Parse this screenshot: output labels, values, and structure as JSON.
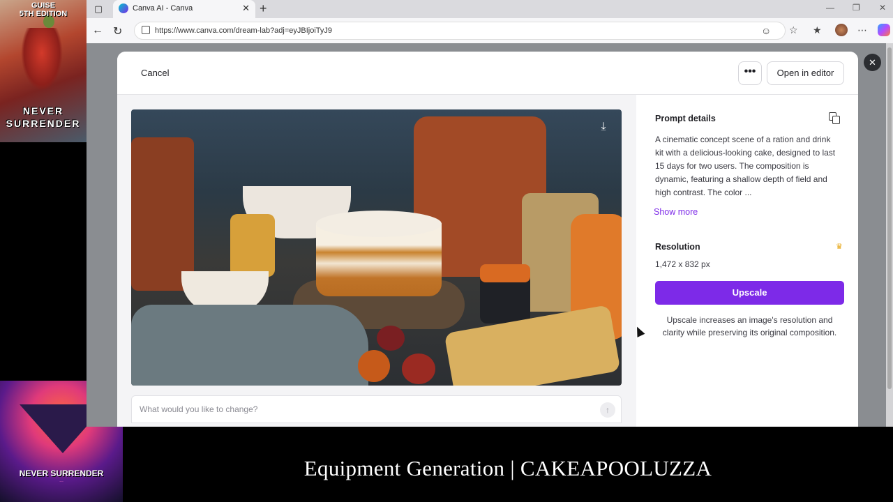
{
  "overlays": {
    "top_poster": {
      "line1": "GUISE",
      "line2": "5TH EDITION",
      "line3": "NEVER",
      "line4": "SURRENDER"
    },
    "bottom_poster": {
      "title": "NEVER SURRENDER",
      "subtitle": "..."
    },
    "caption": "Equipment Generation | CAKEAPOOLUZZA"
  },
  "browser": {
    "tab": {
      "title": "Canva AI - Canva"
    },
    "url": "https://www.canva.com/dream-lab?adj=eyJBIjoiTyJ9"
  },
  "modal": {
    "header": {
      "cancel_label": "Cancel",
      "more_label": "•••",
      "open_editor_label": "Open in editor"
    },
    "prompt_input": {
      "placeholder": "What would you like to change?"
    },
    "details": {
      "title": "Prompt details",
      "prompt_text": "A cinematic concept scene of a ration and drink kit with a delicious-looking cake, designed to last 15 days for two users.  The composition is dynamic, featuring a shallow depth of field and high contrast. The color ...",
      "show_more_label": "Show more",
      "resolution_label": "Resolution",
      "resolution_value": "1,472 x 832 px",
      "upscale_label": "Upscale",
      "upscale_description": "Upscale increases an image's resolution and clarity while preserving its original composition."
    }
  },
  "colors": {
    "accent": "#7d2ae8",
    "crown": "#e6a410"
  },
  "icons": {
    "download": "download-icon",
    "copy": "copy-icon",
    "crown": "crown-icon",
    "send": "send-icon",
    "close": "close-icon"
  }
}
